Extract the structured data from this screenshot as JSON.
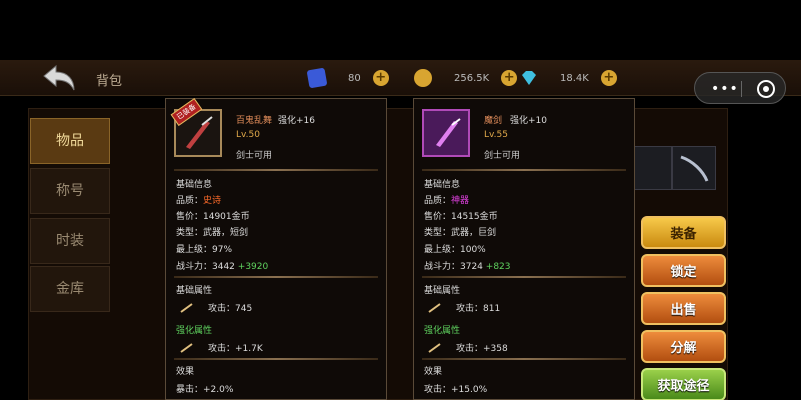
{
  "header": {
    "title": "背包",
    "resources": [
      {
        "name": "card",
        "value": "80",
        "color": "#3a5ad8"
      },
      {
        "name": "gold-coin",
        "value": "256.5K",
        "color": "#d8a531"
      },
      {
        "name": "diamond",
        "value": "18.4K",
        "color": "#3fbfe0"
      }
    ],
    "plus": "+"
  },
  "capsule": {
    "more": "•••"
  },
  "sidebar": {
    "items": [
      {
        "label": "物品",
        "active": true
      },
      {
        "label": "称号",
        "active": false
      },
      {
        "label": "时装",
        "active": false
      },
      {
        "label": "金库",
        "active": false
      }
    ]
  },
  "items": [
    {
      "badge": "已装备",
      "name": "百鬼乱舞",
      "enhance": "强化+16",
      "level": "Lv.50",
      "usable": "剑士可用",
      "basic_title": "基础信息",
      "quality_label": "品质：",
      "quality": "史诗",
      "quality_color": "#ff6b2a",
      "price": "售价：14901金币",
      "type": "类型：武器，短剑",
      "max_level": "最上级：97%",
      "power_label": "战斗力：3442",
      "power_bonus": "+3920",
      "attr_title": "基础属性",
      "attr_value": "攻击：745",
      "enh_title": "强化属性",
      "enh_value": "攻击：+1.7K",
      "effect_title": "效果",
      "effect_value": "暴击：+2.0%"
    },
    {
      "badge": "",
      "name": "魔剑",
      "enhance": "强化+10",
      "level": "Lv.55",
      "usable": "剑士可用",
      "basic_title": "基础信息",
      "quality_label": "品质：",
      "quality": "神器",
      "quality_color": "#e040e0",
      "price": "售价：14515金币",
      "type": "类型：武器，巨剑",
      "max_level": "最上级：100%",
      "power_label": "战斗力：3724",
      "power_bonus": "+823",
      "attr_title": "基础属性",
      "attr_value": "攻击：811",
      "enh_title": "强化属性",
      "enh_value": "攻击：+358",
      "effect_title": "效果",
      "effect_value": "攻击：+15.0%"
    }
  ],
  "actions": [
    {
      "label": "装备",
      "style": "yellow"
    },
    {
      "label": "锁定",
      "style": "orange"
    },
    {
      "label": "出售",
      "style": "orange"
    },
    {
      "label": "分解",
      "style": "orange"
    },
    {
      "label": "获取途径",
      "style": "green"
    }
  ]
}
